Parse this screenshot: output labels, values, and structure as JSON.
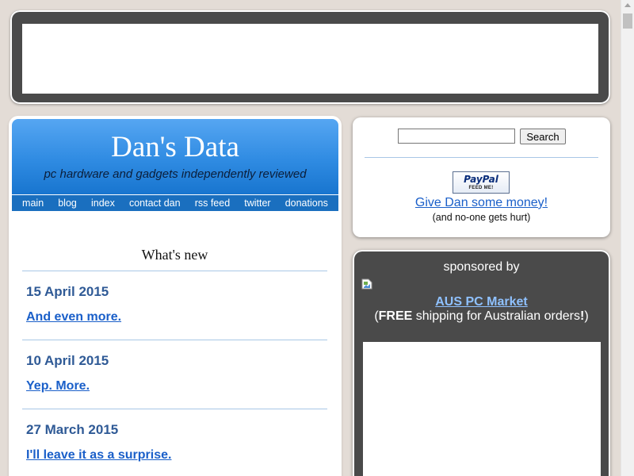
{
  "site": {
    "title": "Dan's Data",
    "tagline": "pc hardware and gadgets independently reviewed"
  },
  "nav": [
    {
      "label": "main"
    },
    {
      "label": "blog"
    },
    {
      "label": "index"
    },
    {
      "label": "contact dan"
    },
    {
      "label": "rss feed"
    },
    {
      "label": "twitter"
    },
    {
      "label": "donations"
    }
  ],
  "whats_new": {
    "heading": "What's new",
    "items": [
      {
        "date": "15 April 2015",
        "link": "And even more."
      },
      {
        "date": "10 April 2015",
        "link": "Yep. More."
      },
      {
        "date": "27 March 2015",
        "link": "I'll leave it as a surprise."
      }
    ]
  },
  "search": {
    "value": "",
    "button_label": "Search"
  },
  "donate": {
    "badge_word": "PayPal",
    "badge_sub": "FEED ME!",
    "link": "Give Dan some money!",
    "note": "(and no-one gets hurt)"
  },
  "sponsor": {
    "heading": "sponsored by",
    "name": "AUS PC Market",
    "offer_open": "(",
    "offer_bold1": "FREE",
    "offer_mid": " shipping for Australian orders",
    "offer_bold2": "!",
    "offer_close": ")"
  },
  "icons": {
    "broken_image": "broken-image-icon",
    "scroll_up": "chevron-up-icon"
  },
  "colors": {
    "page_bg": "#e3dcd6",
    "panel_dark": "#4a4a4a",
    "masthead_blue": "#2f8be2",
    "nav_blue": "#1a6fbf",
    "date_blue": "#2f5a96",
    "link_blue": "#1a5fc9",
    "sponsor_link": "#8fc1ff"
  }
}
